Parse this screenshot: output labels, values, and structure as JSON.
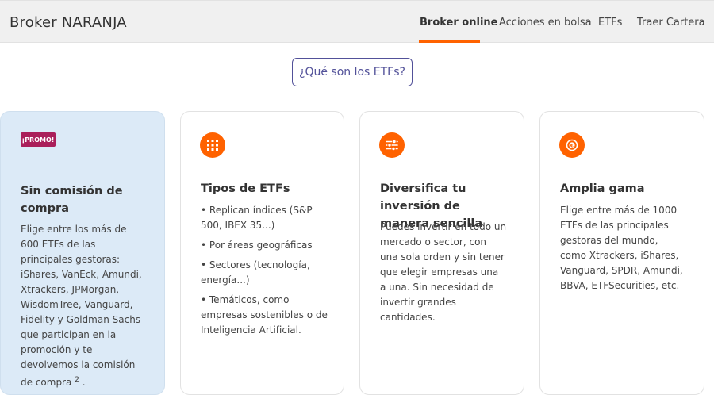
{
  "header": {
    "brand": "Broker NARANJA",
    "nav": [
      {
        "label": "Broker online"
      },
      {
        "label": "Acciones en bolsa"
      },
      {
        "label": "ETFs"
      },
      {
        "label": "Traer Cartera"
      }
    ]
  },
  "etf_button": {
    "label": "¿Qué son los ETFs?"
  },
  "cards": [
    {
      "badge": "¡PROMO!",
      "title": "Sin comisión de compra",
      "text": "Elige entre los más de 600 ETFs de las principales gestoras: iShares, VanEck, Amundi, Xtrackers, JPMorgan, WisdomTree, Vanguard, Fidelity y Goldman Sachs que participan en la promoción y te devolvemos la comisión de compra",
      "footnote": "2",
      "end": "."
    },
    {
      "icon": "grid-icon",
      "title": "Tipos de ETFs",
      "bullets": [
        "• Replican índices (S&P 500, IBEX 35...)",
        "• Por áreas geográficas",
        "• Sectores (tecnología, energía...)",
        "• Temáticos, como empresas sostenibles o de Inteligencia Artificial."
      ]
    },
    {
      "icon": "sliders-icon",
      "title": "Diversifica tu inversión de manera sencilla",
      "text": "Puedes invertir en todo un mercado o sector, con una sola orden y sin tener que elegir empresas una a una. Sin necesidad de invertir grandes cantidades."
    },
    {
      "icon": "euro-coin-icon",
      "title": "Amplia gama",
      "text": "Elige entre más de 1000 ETFs de las principales gestoras del mundo, como Xtrackers, iShares, Vanguard, SPDR, Amundi, BBVA, ETFSecurities, etc."
    }
  ],
  "colors": {
    "accent": "#ff6200",
    "promo_bg": "#dceaf7",
    "badge": "#aa1f5a",
    "button": "#525199"
  }
}
